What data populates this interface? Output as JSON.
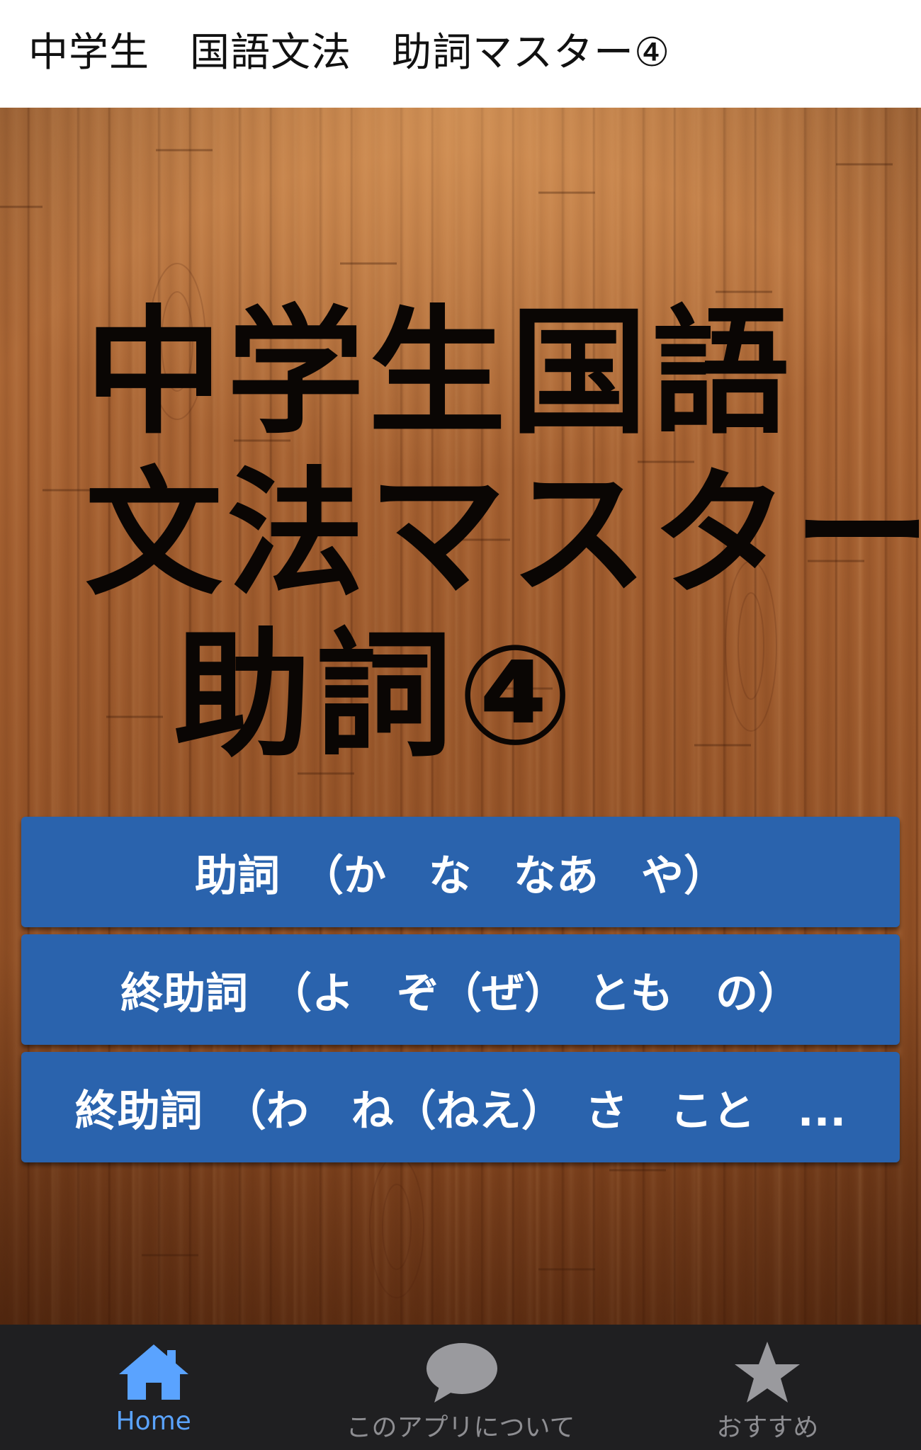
{
  "app_bar": {
    "title": "中学生　国語文法　助詞マスター④"
  },
  "hero": {
    "line1": "中学生国語",
    "line2": "文法マスター",
    "line3": "助詞④"
  },
  "menu": {
    "items": [
      {
        "label": "助詞　（か　な　なあ　や）"
      },
      {
        "label": "終助詞　（よ　ぞ（ぜ）　とも　の）"
      },
      {
        "label": "終助詞　（わ　ね（ねえ）　さ　こと　..."
      }
    ]
  },
  "bottom_nav": {
    "items": [
      {
        "label": "Home",
        "icon": "home-icon",
        "active": true
      },
      {
        "label": "このアプリについて",
        "icon": "chat-bubble-icon",
        "active": false
      },
      {
        "label": "おすすめ",
        "icon": "star-icon",
        "active": false
      }
    ]
  },
  "colors": {
    "button_blue": "#2a63ad",
    "nav_active": "#5aa3ff",
    "nav_inactive": "#8e8e92",
    "nav_bg": "#1f1f21"
  }
}
